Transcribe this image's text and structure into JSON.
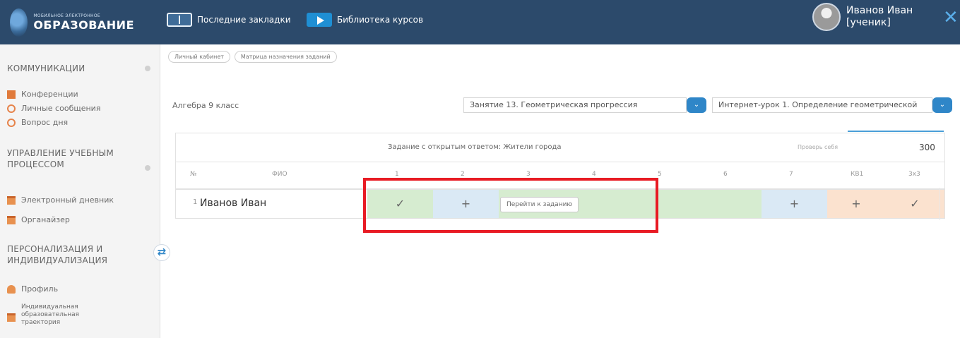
{
  "app": {
    "logo_small": "МОБИЛЬНОЕ ЭЛЕКТРОННОЕ",
    "logo_big": "ОБРАЗОВАНИЕ"
  },
  "topnav": [
    {
      "label": "Последние закладки",
      "icon": "bookmarks-icon"
    },
    {
      "label": "Библиотека курсов",
      "icon": "course-library-icon"
    }
  ],
  "user": {
    "name": "Иванов Иван",
    "role": "[ученик]"
  },
  "sidebar": {
    "sections": [
      {
        "title": "КОММУНИКАЦИИ"
      },
      {
        "title": "УПРАВЛЕНИЕ УЧЕБНЫМ ПРОЦЕССОМ"
      },
      {
        "title": "ПЕРСОНАЛИЗАЦИЯ И ИНДИВИДУАЛИЗАЦИЯ"
      }
    ],
    "items": [
      {
        "label": "Конференции",
        "icon": "conference-icon"
      },
      {
        "label": "Личные сообщения",
        "icon": "messages-icon"
      },
      {
        "label": "Вопрос дня",
        "icon": "question-icon"
      },
      {
        "label": "Электронный дневник",
        "icon": "diary-icon"
      },
      {
        "label": "Органайзер",
        "icon": "organizer-icon"
      },
      {
        "label": "Профиль",
        "icon": "profile-icon"
      },
      {
        "label": "Индивидуальная образовательная траектория",
        "icon": "trajectory-icon"
      }
    ]
  },
  "breadcrumbs": [
    "Личный кабинет",
    "Матрица назначения заданий"
  ],
  "subject": "Алгебра 9 класс",
  "filters": {
    "lesson": "Занятие 13. Геометрическая прогрессия",
    "lesson_part": "Интернет-урок 1. Определение геометрической"
  },
  "table": {
    "task_title": "Задание с открытым ответом: Жители города",
    "check_label": "Проверь себя",
    "score": "300",
    "headers": [
      "№",
      "ФИО",
      "1",
      "2",
      "3",
      "4",
      "5",
      "6",
      "7",
      "КВ1",
      "3х3"
    ],
    "rows": [
      {
        "num": "1",
        "name": "Иванов Иван",
        "cells": [
          "✓",
          "+",
          "",
          "",
          "",
          "",
          "+",
          "+",
          "✓"
        ]
      }
    ]
  },
  "tooltip": "Перейти к заданию",
  "colors": {
    "topbar": "#2c4a6b",
    "accent": "#2f86c8",
    "done": "#d6ecd0",
    "assigned": "#dae9f5",
    "control": "#fbe2cf",
    "highlight": "#e81b24"
  }
}
